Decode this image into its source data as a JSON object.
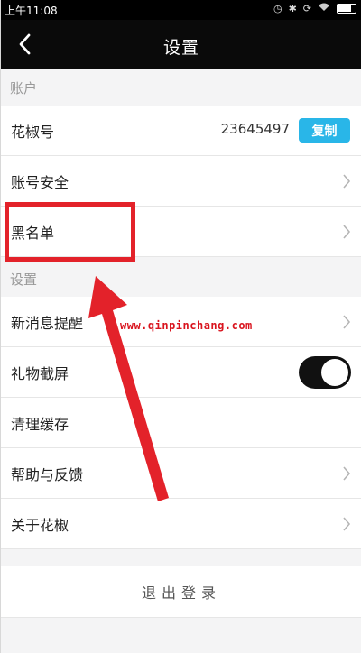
{
  "status_bar": {
    "time": "上午11:08",
    "icons": [
      "alarm-icon",
      "bluetooth-icon",
      "sync-icon",
      "wifi-icon",
      "battery-icon"
    ]
  },
  "nav": {
    "title": "设置",
    "back_icon": "chevron-left-icon"
  },
  "sections": {
    "account_header": "账户",
    "settings_header": "设置"
  },
  "account": {
    "id_label": "花椒号",
    "id_value": "23645497",
    "copy_label": "复制",
    "security_label": "账号安全",
    "blacklist_label": "黑名单"
  },
  "settings": {
    "new_message_label": "新消息提醒",
    "gift_screen_label": "礼物截屏",
    "gift_screen_on": true,
    "clear_cache_label": "清理缓存",
    "help_feedback_label": "帮助与反馈",
    "about_label": "关于花椒"
  },
  "logout": {
    "label": "退出登录"
  },
  "annotation": {
    "watermark": "www.qinpinchang.com",
    "highlight_color": "#e3222a",
    "arrow_color": "#e3222a"
  },
  "colors": {
    "nav_bg": "#0a0a0a",
    "copy_button": "#29b6e8",
    "section_bg": "#f4f4f5"
  }
}
